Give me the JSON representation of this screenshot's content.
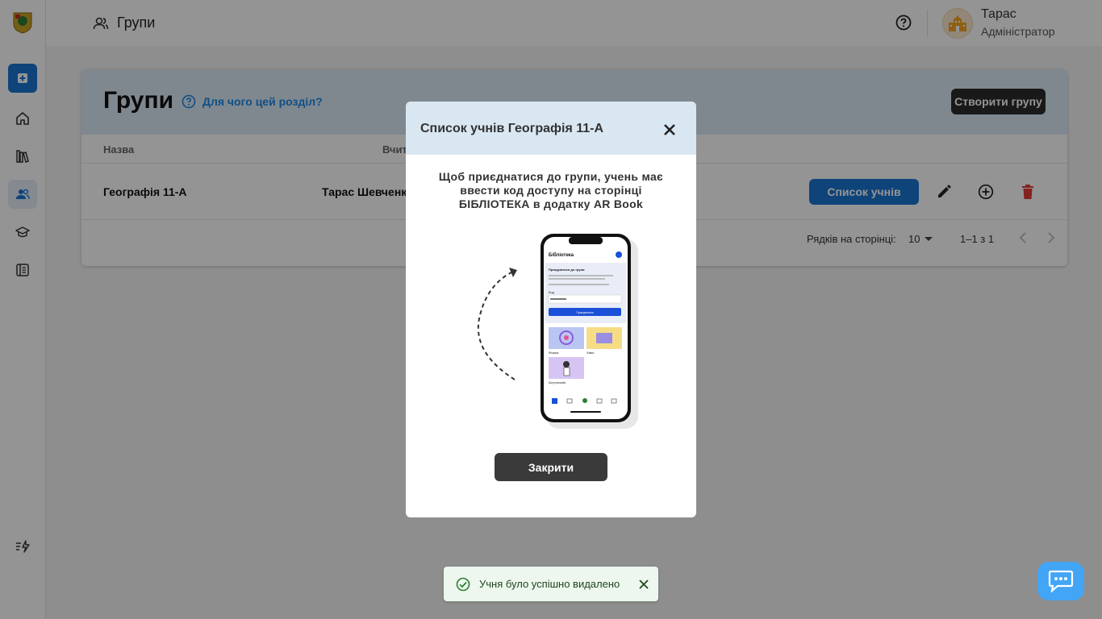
{
  "topbar": {
    "title": "Групи",
    "user_name": "Тарас",
    "user_role": "Адміністратор"
  },
  "page": {
    "title": "Групи",
    "help_link": "Для чого цей розділ?",
    "create_button": "Створити групу",
    "columns": [
      "Назва",
      "Вчит"
    ],
    "rows": [
      {
        "name": "Географія 11-А",
        "teacher": "Тарас Шевченк",
        "students_button": "Список учнів"
      }
    ],
    "pagination": {
      "rows_per_page_label": "Рядків на сторінці:",
      "rows_per_page_value": "10",
      "range": "1–1 з 1"
    }
  },
  "modal": {
    "title": "Список учнів Географія 11-А",
    "instruction": "Щоб приєднатися до групи, учень має ввести код доступу на сторінці БІБЛІОТЕКА в додатку AR Book",
    "close_button": "Закрити",
    "phone": {
      "header": "Бібліотека",
      "join_title": "Приєднатися до групи",
      "code_label": "Код",
      "join_button": "Приєднатися",
      "books": [
        "Фізика",
        "Хімія",
        "Астрономія"
      ]
    }
  },
  "toast": {
    "message": "Учня було успішно видалено"
  },
  "colors": {
    "primary": "#1976d2",
    "header_bg": "#dbeaf6",
    "dark_button": "#2b2b2b",
    "delete": "#e53935",
    "toast_bg": "#edf7ed",
    "chat": "#42a5f5"
  }
}
